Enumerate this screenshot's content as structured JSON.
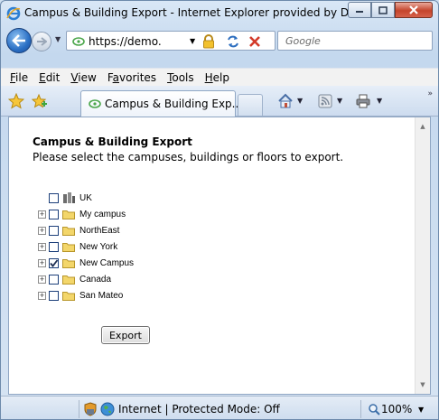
{
  "window": {
    "title": "Campus & Building Export - Internet Explorer provided by Dell"
  },
  "address_bar": {
    "url": "https://demo.",
    "search_placeholder": "Google"
  },
  "menu": [
    {
      "label": "File",
      "key": "F",
      "rest": "ile"
    },
    {
      "label": "Edit",
      "key": "E",
      "rest": "dit"
    },
    {
      "label": "View",
      "key": "V",
      "rest": "iew"
    },
    {
      "label": "Favorites",
      "key": "",
      "pre": "F",
      "keymid": "a",
      "rest": "vorites"
    },
    {
      "label": "Tools",
      "key": "T",
      "rest": "ools"
    },
    {
      "label": "Help",
      "key": "H",
      "rest": "elp"
    }
  ],
  "tab": {
    "label": "Campus & Building Exp..."
  },
  "page": {
    "title": "Campus & Building Export",
    "subtitle": "Please select the campuses, buildings or floors to export.",
    "tree": [
      {
        "label": "UK",
        "checked": false,
        "expandable": false,
        "icon": "building-icon"
      },
      {
        "label": "My campus",
        "checked": false,
        "expandable": true,
        "icon": "folder-icon"
      },
      {
        "label": "NorthEast",
        "checked": false,
        "expandable": true,
        "icon": "folder-icon"
      },
      {
        "label": "New York",
        "checked": false,
        "expandable": true,
        "icon": "folder-icon"
      },
      {
        "label": "New Campus",
        "checked": true,
        "expandable": true,
        "icon": "folder-icon"
      },
      {
        "label": "Canada",
        "checked": false,
        "expandable": true,
        "icon": "folder-icon"
      },
      {
        "label": "San Mateo",
        "checked": false,
        "expandable": true,
        "icon": "folder-icon"
      }
    ],
    "export_label": "Export"
  },
  "status": {
    "zone": "Internet | Protected Mode: Off",
    "zoom": "100%"
  },
  "colors": {
    "window_frame": "#c4d8ee",
    "close_button": "#c5442b",
    "content_bg": "#ffffff",
    "checkbox_border": "#1c3f7a",
    "folder": "#f3d66a"
  }
}
